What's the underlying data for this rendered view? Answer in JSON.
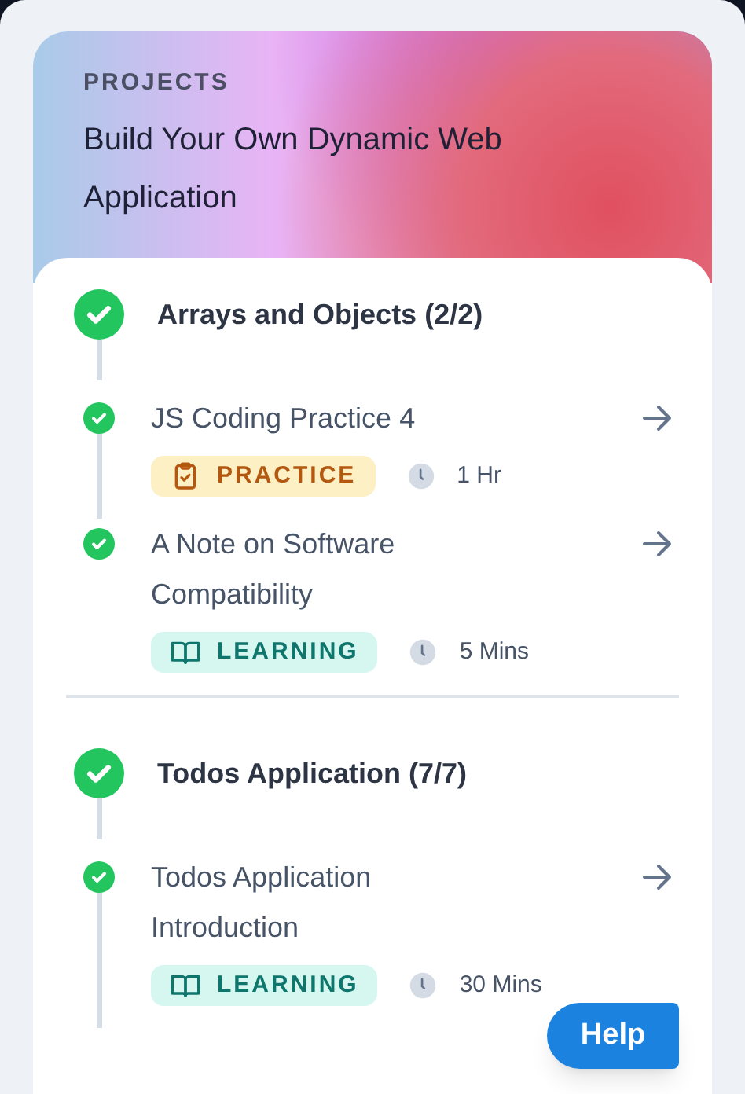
{
  "header": {
    "eyebrow": "PROJECTS",
    "title": "Build Your Own Dynamic Web Application"
  },
  "sections": [
    {
      "title": "Arrays and Objects (2/2)",
      "completed": true,
      "items": [
        {
          "title": "JS Coding Practice 4",
          "completed": true,
          "kind": "practice",
          "tag": "PRACTICE",
          "duration": "1 Hr"
        },
        {
          "title": "A Note on Software Compatibility",
          "completed": true,
          "kind": "learning",
          "tag": "LEARNING",
          "duration": "5 Mins"
        }
      ]
    },
    {
      "title": "Todos Application (7/7)",
      "completed": true,
      "items": [
        {
          "title": "Todos Application Introduction",
          "completed": true,
          "kind": "learning",
          "tag": "LEARNING",
          "duration": "30 Mins"
        }
      ]
    }
  ],
  "help_button": "Help"
}
